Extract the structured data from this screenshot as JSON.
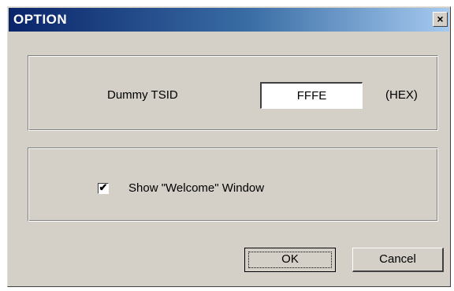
{
  "window": {
    "title": "OPTION",
    "close_glyph": "×"
  },
  "tsid": {
    "label": "Dummy TSID",
    "value": "FFFE",
    "unit": "(HEX)"
  },
  "welcome": {
    "label": "Show \"Welcome\" Window",
    "checked": true,
    "check_glyph": "✔"
  },
  "buttons": {
    "ok": "OK",
    "cancel": "Cancel"
  }
}
